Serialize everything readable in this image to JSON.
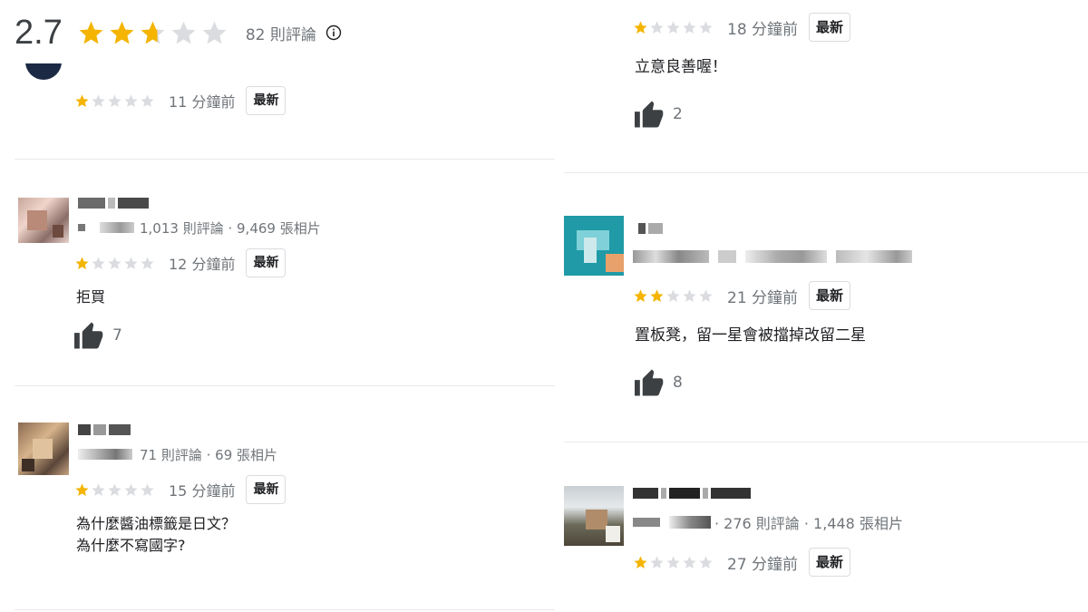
{
  "summary": {
    "rating": "2.7",
    "rating_value": 2.7,
    "review_count": "82 則評論",
    "info_icon": "info-icon"
  },
  "colors": {
    "star_filled": "#f4b400",
    "star_empty": "#dadce0",
    "meta_text": "#70757a"
  },
  "reviews": [
    {
      "rating": 1,
      "time": "11 分鐘前",
      "tag": "最新"
    },
    {
      "stats": "1,013 則評論 · 9,469 張相片",
      "rating": 1,
      "time": "12 分鐘前",
      "tag": "最新",
      "text": "拒買",
      "likes": "7"
    },
    {
      "stats": "71 則評論 · 69 張相片",
      "rating": 1,
      "time": "15 分鐘前",
      "tag": "最新",
      "text_line1": "為什麼醬油標籤是日文？",
      "text_line2": "為什麼不寫國字?"
    },
    {
      "rating": 1,
      "time": "18 分鐘前",
      "tag": "最新",
      "text": "立意良善喔！",
      "likes": "2"
    },
    {
      "rating": 2,
      "time": "21 分鐘前",
      "tag": "最新",
      "text": "置板凳，留一星會被擋掉改留二星",
      "likes": "8"
    },
    {
      "stats": "· 276 則評論 · 1,448 張相片",
      "rating": 1,
      "time": "27 分鐘前",
      "tag": "最新"
    }
  ]
}
